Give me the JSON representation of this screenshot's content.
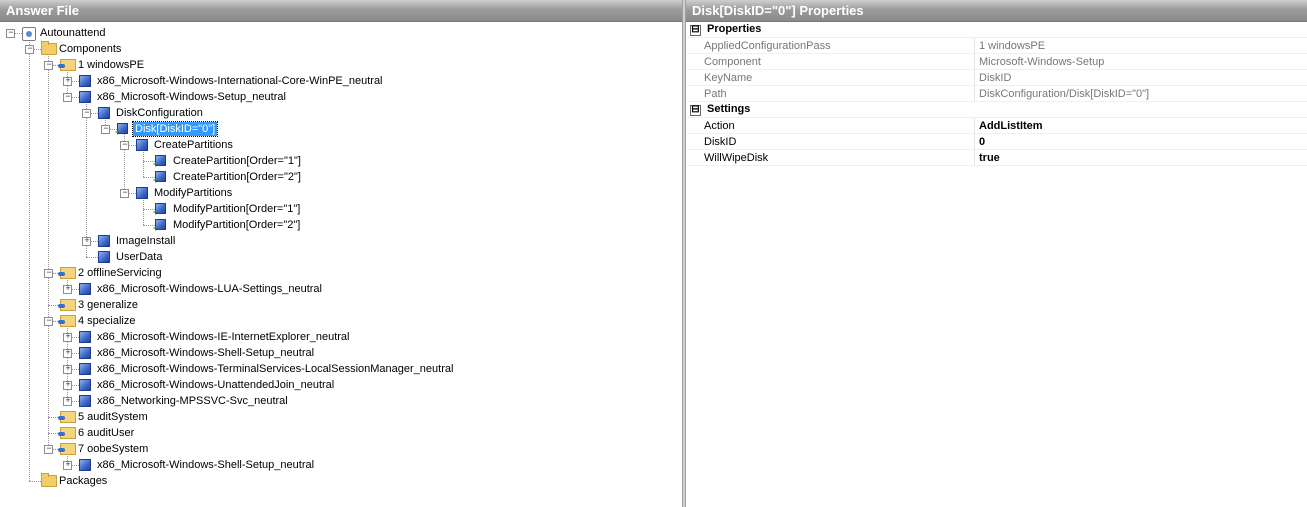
{
  "answer_file": {
    "title": "Answer File",
    "tree": [
      {
        "label": "Autounattend",
        "icon": "answer-file-icon"
      },
      {
        "label": "Components",
        "icon": "folder-icon"
      },
      {
        "label": "1 windowsPE",
        "icon": "configuration-pass-icon"
      },
      {
        "label": "x86_Microsoft-Windows-International-Core-WinPE_neutral",
        "icon": "component-icon"
      },
      {
        "label": "x86_Microsoft-Windows-Setup_neutral",
        "icon": "component-icon"
      },
      {
        "label": "DiskConfiguration",
        "icon": "setting-icon"
      },
      {
        "label": "Disk[DiskID=\"0\"]",
        "icon": "list-item-icon",
        "selected": true
      },
      {
        "label": "CreatePartitions",
        "icon": "setting-icon"
      },
      {
        "label": "CreatePartition[Order=\"1\"]",
        "icon": "list-item-icon"
      },
      {
        "label": "CreatePartition[Order=\"2\"]",
        "icon": "list-item-icon"
      },
      {
        "label": "ModifyPartitions",
        "icon": "setting-icon"
      },
      {
        "label": "ModifyPartition[Order=\"1\"]",
        "icon": "list-item-icon"
      },
      {
        "label": "ModifyPartition[Order=\"2\"]",
        "icon": "list-item-icon"
      },
      {
        "label": "ImageInstall",
        "icon": "setting-icon"
      },
      {
        "label": "UserData",
        "icon": "setting-icon"
      },
      {
        "label": "2 offlineServicing",
        "icon": "configuration-pass-icon"
      },
      {
        "label": "x86_Microsoft-Windows-LUA-Settings_neutral",
        "icon": "component-icon"
      },
      {
        "label": "3 generalize",
        "icon": "configuration-pass-icon"
      },
      {
        "label": "4 specialize",
        "icon": "configuration-pass-icon"
      },
      {
        "label": "x86_Microsoft-Windows-IE-InternetExplorer_neutral",
        "icon": "component-icon"
      },
      {
        "label": "x86_Microsoft-Windows-Shell-Setup_neutral",
        "icon": "component-icon"
      },
      {
        "label": "x86_Microsoft-Windows-TerminalServices-LocalSessionManager_neutral",
        "icon": "component-icon"
      },
      {
        "label": "x86_Microsoft-Windows-UnattendedJoin_neutral",
        "icon": "component-icon"
      },
      {
        "label": "x86_Networking-MPSSVC-Svc_neutral",
        "icon": "component-icon"
      },
      {
        "label": "5 auditSystem",
        "icon": "configuration-pass-icon"
      },
      {
        "label": "6 auditUser",
        "icon": "configuration-pass-icon"
      },
      {
        "label": "7 oobeSystem",
        "icon": "configuration-pass-icon"
      },
      {
        "label": "x86_Microsoft-Windows-Shell-Setup_neutral",
        "icon": "component-icon"
      },
      {
        "label": "Packages",
        "icon": "folder-icon"
      }
    ]
  },
  "properties_panel": {
    "title": "Disk[DiskID=\"0\"] Properties",
    "categories": [
      {
        "name": "Properties",
        "collapse_glyph": "⊟",
        "rows": [
          {
            "name": "AppliedConfigurationPass",
            "value": "1 windowsPE"
          },
          {
            "name": "Component",
            "value": "Microsoft-Windows-Setup"
          },
          {
            "name": "KeyName",
            "value": "DiskID"
          },
          {
            "name": "Path",
            "value": "DiskConfiguration/Disk[DiskID=\"0\"]"
          }
        ]
      },
      {
        "name": "Settings",
        "collapse_glyph": "⊟",
        "rows": [
          {
            "name": "Action",
            "value": "AddListItem"
          },
          {
            "name": "DiskID",
            "value": "0"
          },
          {
            "name": "WillWipeDisk",
            "value": "true"
          }
        ]
      }
    ]
  }
}
